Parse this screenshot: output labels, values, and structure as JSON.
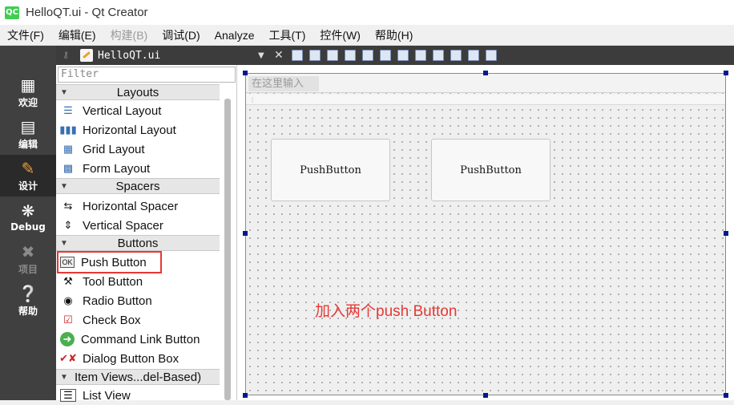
{
  "window": {
    "title": "HelloQT.ui - Qt Creator",
    "app_icon": "QC"
  },
  "menu": [
    {
      "label": "文件(F)",
      "enabled": true
    },
    {
      "label": "编辑(E)",
      "enabled": true
    },
    {
      "label": "构建(B)",
      "enabled": false
    },
    {
      "label": "调试(D)",
      "enabled": true
    },
    {
      "label": "Analyze",
      "enabled": true
    },
    {
      "label": "工具(T)",
      "enabled": true
    },
    {
      "label": "控件(W)",
      "enabled": true
    },
    {
      "label": "帮助(H)",
      "enabled": true
    }
  ],
  "modes": {
    "welcome": {
      "label": "欢迎",
      "icon": "grid-icon"
    },
    "edit": {
      "label": "编辑",
      "icon": "document-icon"
    },
    "design": {
      "label": "设计",
      "icon": "pencil-icon"
    },
    "debug": {
      "label": "Debug",
      "icon": "bug-icon"
    },
    "projects": {
      "label": "项目",
      "icon": "wrench-icon"
    },
    "help": {
      "label": "帮助",
      "icon": "question-icon"
    }
  },
  "toolbar": {
    "filename": "HelloQT.ui"
  },
  "widgetbox": {
    "filter_placeholder": "Filter",
    "cat_layouts": "Layouts",
    "vertical_layout": "Vertical Layout",
    "horizontal_layout": "Horizontal Layout",
    "grid_layout": "Grid Layout",
    "form_layout": "Form Layout",
    "cat_spacers": "Spacers",
    "horizontal_spacer": "Horizontal Spacer",
    "vertical_spacer": "Vertical Spacer",
    "cat_buttons": "Buttons",
    "push_button": "Push Button",
    "tool_button": "Tool Button",
    "radio_button": "Radio Button",
    "check_box": "Check Box",
    "command_link_button": "Command Link Button",
    "dialog_button_box": "Dialog Button Box",
    "cat_item_views": "Item Views...del-Based)",
    "list_view": "List View"
  },
  "form": {
    "type_here": "在这里输入",
    "button1": "PushButton",
    "button2": "PushButton"
  },
  "annotation": "加入两个push Button",
  "colors": {
    "highlight": "#e53935",
    "annotation": "#e53935",
    "selection_handle": "#001a8c"
  }
}
